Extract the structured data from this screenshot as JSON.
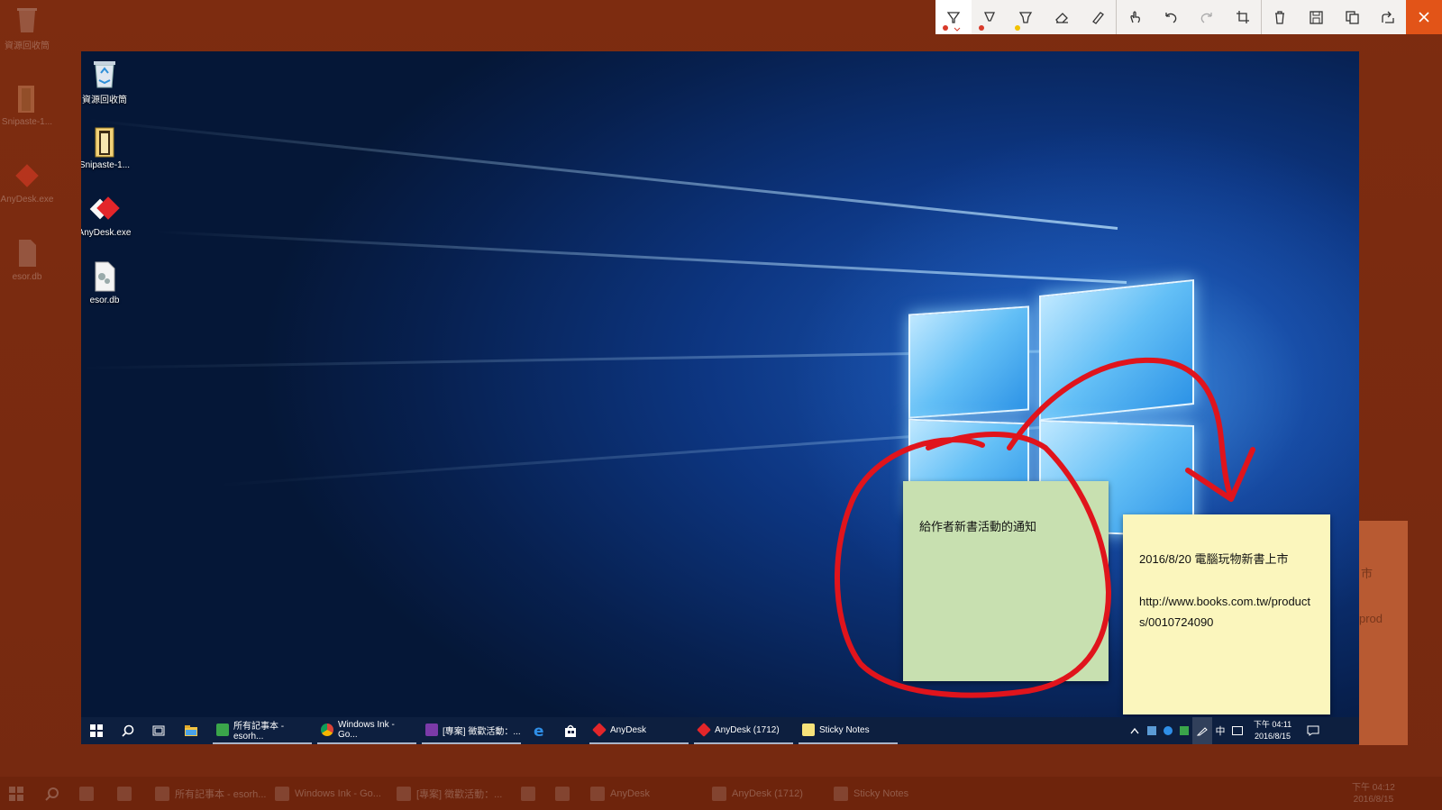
{
  "outer_desktop": {
    "icons": [
      {
        "label": "資源回收筒"
      },
      {
        "label": "Snipaste-1..."
      },
      {
        "label": "AnyDesk.exe"
      },
      {
        "label": "esor.db"
      }
    ],
    "taskbar": {
      "apps": [
        "所有記事本 - esorh...",
        "Windows Ink - Go...",
        "[專案] 徵歡活動：...",
        "AnyDesk",
        "AnyDesk (1712)",
        "Sticky Notes"
      ],
      "time": "下午 04:12",
      "date": "2016/8/15"
    },
    "ghost_note": {
      "line1": "市",
      "line2": "prod"
    }
  },
  "toolbar": {
    "tools": [
      {
        "icon": "ballpoint-pen-icon",
        "color": "#d83a2a",
        "selected": true
      },
      {
        "icon": "pencil-pen-icon",
        "color": "#d83a2a"
      },
      {
        "icon": "highlighter-icon",
        "color": "#f2c200"
      },
      {
        "icon": "eraser-icon"
      },
      {
        "icon": "ruler-icon"
      },
      {
        "icon": "touch-writing-icon"
      },
      {
        "icon": "undo-icon"
      },
      {
        "icon": "redo-icon"
      },
      {
        "icon": "crop-icon"
      },
      {
        "icon": "delete-icon"
      },
      {
        "icon": "save-icon"
      },
      {
        "icon": "copy-icon"
      },
      {
        "icon": "share-icon"
      }
    ],
    "close": "close-icon"
  },
  "inner_desktop": {
    "icons": [
      {
        "label": "資源回收筒"
      },
      {
        "label": "Snipaste-1..."
      },
      {
        "label": "AnyDesk.exe"
      },
      {
        "label": "esor.db"
      }
    ],
    "taskbar": {
      "apps": [
        "所有記事本 - esorh...",
        "Windows Ink - Go...",
        "[專案] 徵歡活動：...",
        "AnyDesk",
        "AnyDesk (1712)",
        "Sticky Notes"
      ],
      "tray_ime": "中",
      "time": "下午 04:11",
      "date": "2016/8/15"
    },
    "sticky_notes": {
      "green": {
        "text": "給作者新書活動的通知",
        "color": "#c8e0b0"
      },
      "yellow": {
        "line1": "2016/8/20 電腦玩物新書上市",
        "line2": "http://www.books.com.tw/products/0010724090",
        "color": "#fbf6bd"
      }
    }
  },
  "ink_color": "#e0141c"
}
